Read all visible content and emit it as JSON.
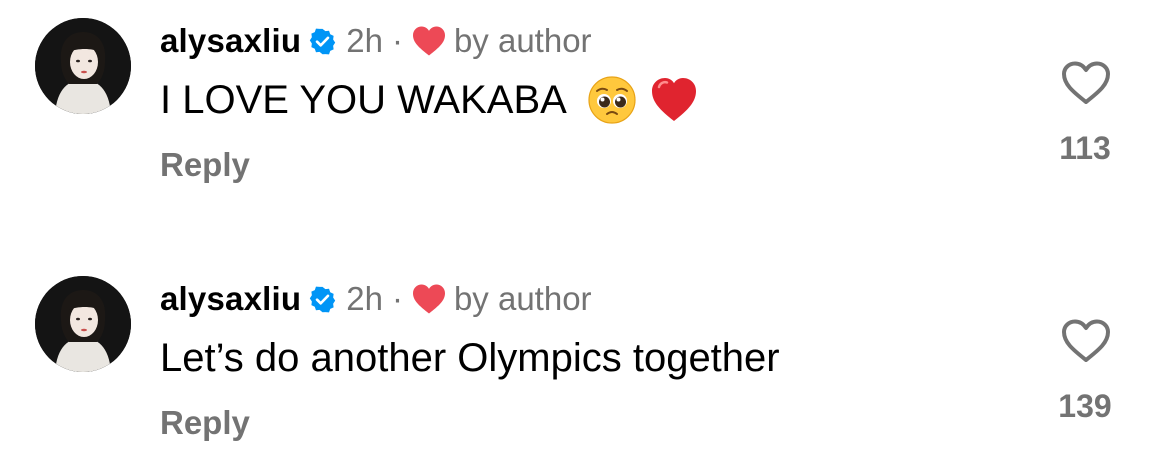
{
  "comments": [
    {
      "username": "alysaxliu",
      "time": "2h",
      "separator": "·",
      "author_badge_label": "by author",
      "text": "I LOVE YOU WAKABA",
      "emojis": [
        "pleading-face-emoji",
        "red-heart-emoji"
      ],
      "reply_label": "Reply",
      "like_count": "113"
    },
    {
      "username": "alysaxliu",
      "time": "2h",
      "separator": "·",
      "author_badge_label": "by author",
      "text": "Let’s do another Olympics together",
      "emojis": [],
      "reply_label": "Reply",
      "like_count": "139"
    }
  ],
  "icons": {
    "verified": "verified-badge-icon",
    "author_heart": "heart-icon",
    "like": "heart-outline-icon"
  },
  "colors": {
    "verified_blue": "#0095F6",
    "author_heart_red": "#ED4956",
    "secondary_text": "#737373",
    "primary_text": "#000000"
  }
}
